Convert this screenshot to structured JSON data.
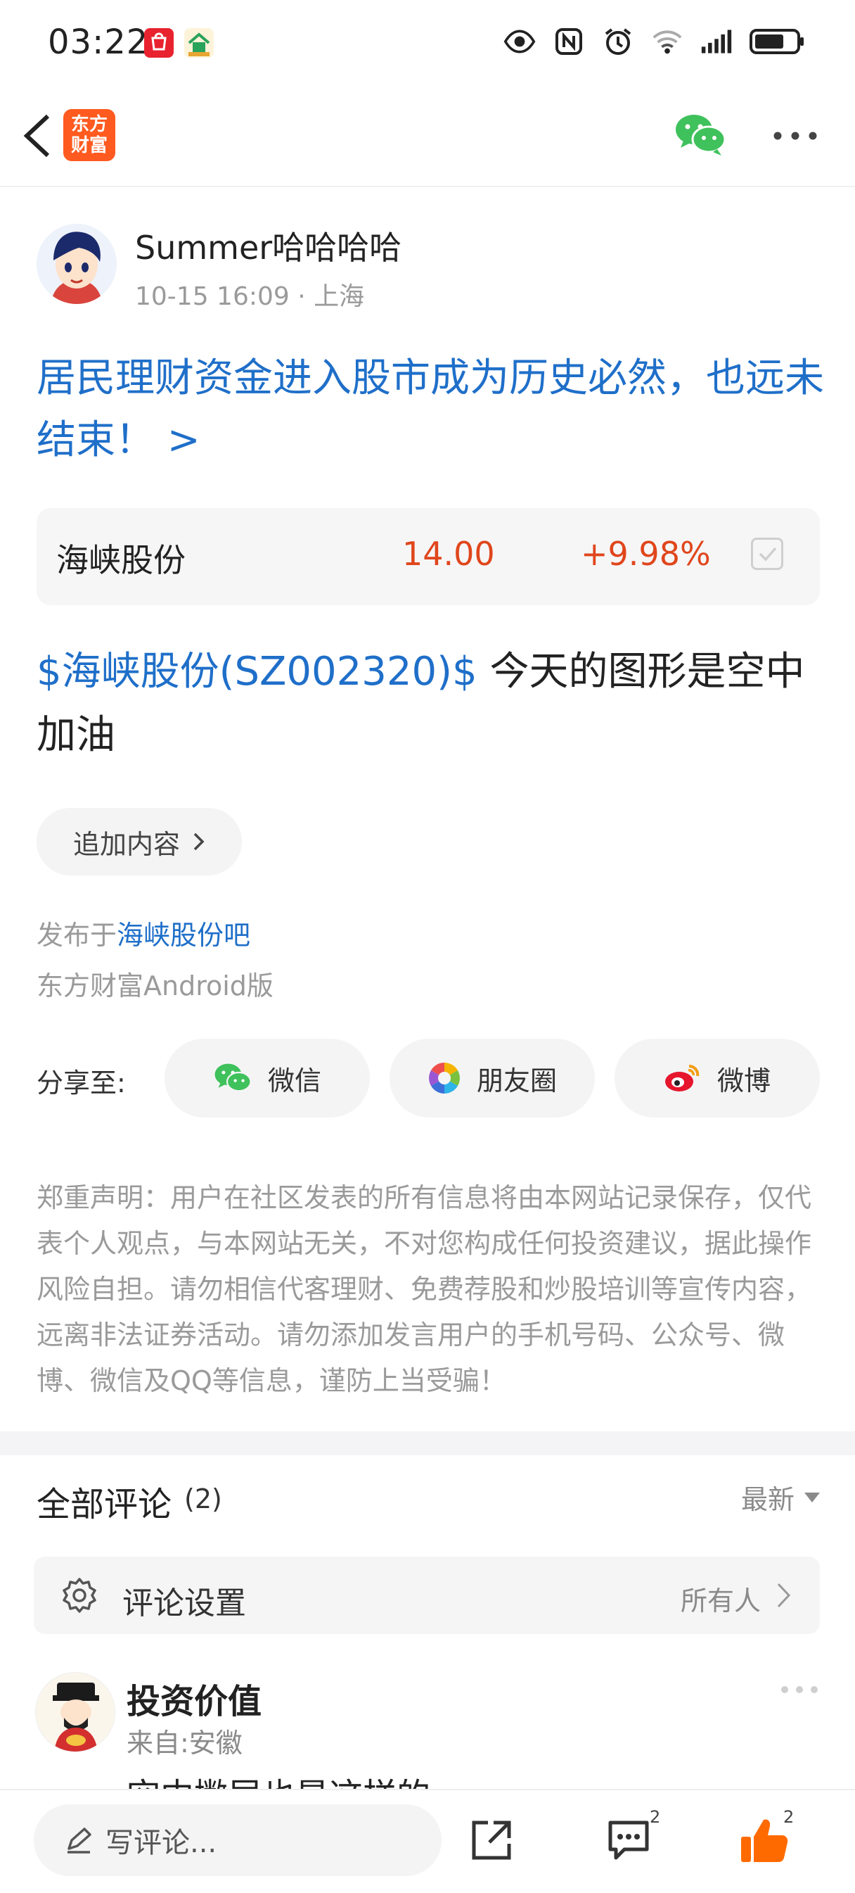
{
  "status_bar": {
    "time": "03:22"
  },
  "header": {
    "brand_line1": "东方",
    "brand_line2": "财富"
  },
  "post": {
    "author": "Summer哈哈哈哈",
    "meta": "10-15 16:09 · 上海",
    "title": "居民理财资金进入股市成为历史必然，也远未结束！ >",
    "stock": {
      "name": "海峡股份",
      "price": "14.00",
      "change": "+9.98%"
    },
    "body_tag": "$海峡股份(SZ002320)$",
    "body_text": " 今天的图形是空中加油",
    "append_label": "追加内容",
    "published_prefix": "发布于",
    "published_bar": "海峡股份吧",
    "client": "东方财富Android版"
  },
  "share": {
    "label": "分享至:",
    "wechat": "微信",
    "moments": "朋友圈",
    "weibo": "微博"
  },
  "disclaimer": "郑重声明：用户在社区发表的所有信息将由本网站记录保存，仅代表个人观点，与本网站无关，不对您构成任何投资建议，据此操作风险自担。请勿相信代客理财、免费荐股和炒股培训等宣传内容，远离非法证券活动。请勿添加发言用户的手机号码、公众号、微博、微信及QQ等信息，谨防上当受骗！",
  "comments": {
    "title": "全部评论",
    "count": "(2)",
    "sort": "最新",
    "settings_label": "评论设置",
    "settings_value": "所有人",
    "first": {
      "user": "投资价值",
      "from": "来自:安徽",
      "text": "空中撇尿也是这样的"
    }
  },
  "bottom_bar": {
    "compose_placeholder": "写评论...",
    "comment_count": "2",
    "like_count": "2"
  },
  "colors": {
    "accent_blue": "#1f6fc9",
    "up_red": "#e0461c",
    "brand_orange": "#ff5a1f",
    "like_orange": "#ff6a00",
    "wechat_green": "#3fc15c"
  }
}
